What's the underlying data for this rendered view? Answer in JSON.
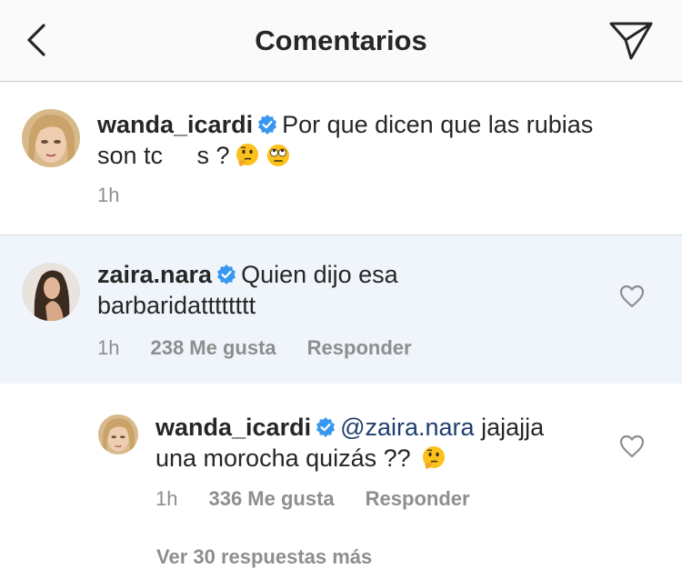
{
  "header": {
    "title": "Comentarios",
    "back_icon": "chevron-left-icon",
    "send_icon": "paper-plane-icon"
  },
  "caption": {
    "username": "wanda_icardi",
    "verified": true,
    "text_line1": "Por que dicen que las rubias",
    "text_line2": "son tc     s ?",
    "emojis": [
      "thinking-face",
      "face-with-rolling-eyes"
    ],
    "time": "1h"
  },
  "comments": [
    {
      "username": "zaira.nara",
      "verified": true,
      "text_line1": "Quien dijo esa",
      "text_line2": "barbaridatttttttt",
      "time": "1h",
      "likes": "238 Me gusta",
      "reply_label": "Responder"
    },
    {
      "username": "wanda_icardi",
      "verified": true,
      "mention": "@zaira.nara",
      "text_line1": "jajajja",
      "text_line2": "una morocha quizás ??",
      "emojis": [
        "thinking-face"
      ],
      "time": "1h",
      "likes": "336 Me gusta",
      "reply_label": "Responder"
    }
  ],
  "view_replies": "Ver 30 respuestas más",
  "colors": {
    "accent_blue": "#3897f0",
    "highlight_bg": "#eff5fb",
    "meta_gray": "#8e8e8e",
    "mention": "#1e3f6e"
  }
}
